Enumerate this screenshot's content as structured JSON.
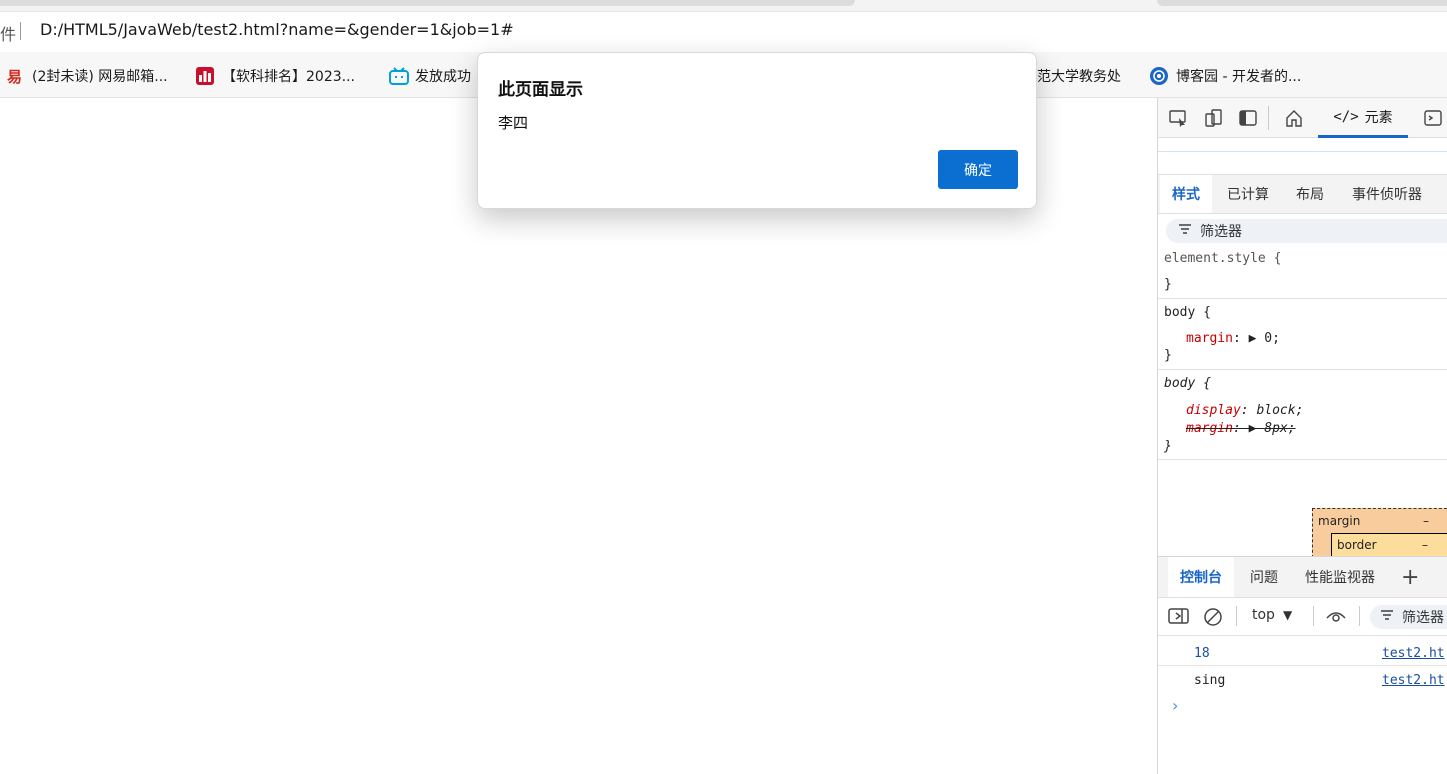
{
  "browser": {
    "address_prefix": "件",
    "url": "D:/HTML5/JavaWeb/test2.html?name=&gender=1&job=1#",
    "bookmarks": [
      {
        "label": "(2封未读) 网易邮箱...",
        "icon": "netease-mail-icon",
        "color": "#d4281c"
      },
      {
        "label": "【软科排名】2023...",
        "icon": "shanghairanking-icon",
        "color": "#c8102e"
      },
      {
        "label": "发放成功",
        "icon": "bilibili-icon",
        "color": "#00a1d6"
      },
      {
        "label": "范大学教务处",
        "icon": "",
        "color": ""
      },
      {
        "label": "博客园 - 开发者的...",
        "icon": "cnblogs-icon",
        "color": "#1a66c6"
      }
    ]
  },
  "dialog": {
    "title": "此页面显示",
    "message": "李四",
    "ok_label": "确定",
    "accent": "#0a6fd0"
  },
  "devtools": {
    "elements_tab": "元素",
    "style_tabs": [
      "样式",
      "已计算",
      "布局",
      "事件侦听器"
    ],
    "filter_label": "筛选器",
    "rules": {
      "element_style_selector": "element.style {",
      "close": "}",
      "body1_selector": "body {",
      "body1_prop": "margin",
      "body1_val": "0;",
      "body2_selector": "body {",
      "body2_prop1": "display",
      "body2_val1": "block;",
      "body2_prop2": "margin",
      "body2_val2": "8px;"
    },
    "box_model": {
      "margin_label": "margin",
      "margin_value": "–",
      "border_label": "border",
      "border_value": "–"
    },
    "drawer_tabs": [
      "控制台",
      "问题",
      "性能监视器"
    ],
    "console_toolbar": {
      "context": "top",
      "filter_label": "筛选器"
    },
    "console_rows": [
      {
        "message": "18",
        "source": "test2.ht",
        "color": "#1a4fa0"
      },
      {
        "message": "sing",
        "source": "test2.ht",
        "color": "#222222"
      }
    ]
  }
}
